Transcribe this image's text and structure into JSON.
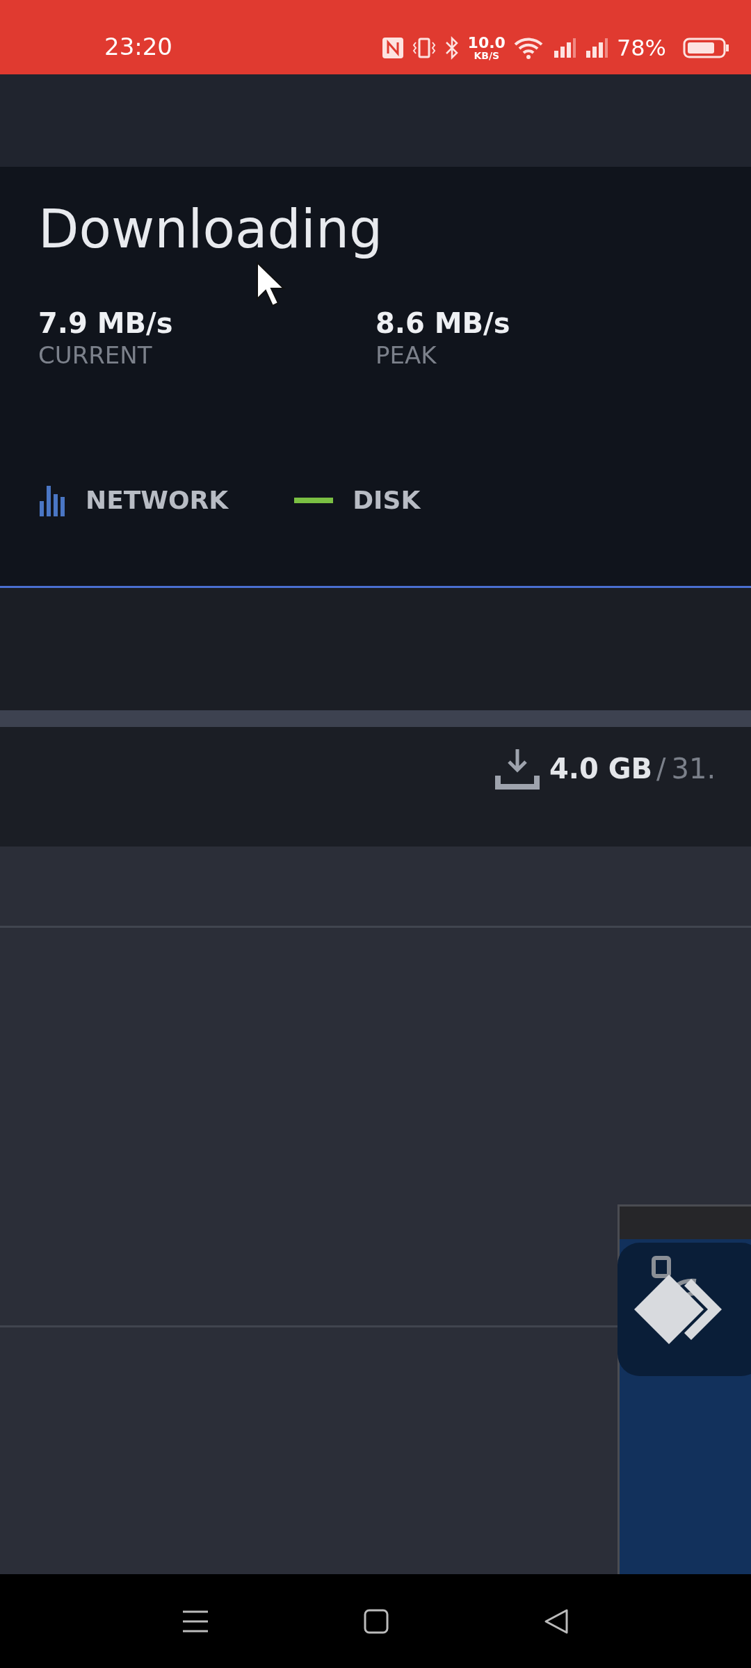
{
  "status_bar": {
    "time": "23:20",
    "net_speed": "10.0",
    "net_unit": "KB/S",
    "battery": "78%"
  },
  "downloads": {
    "title": "Downloading",
    "stats": [
      {
        "value": "7.9 MB/s",
        "label": "CURRENT"
      },
      {
        "value": "8.6 MB/s",
        "label": "PEAK"
      }
    ],
    "legend": [
      {
        "label": "NETWORK",
        "kind": "bars",
        "color": "#4a76c4"
      },
      {
        "label": "DISK",
        "kind": "line",
        "color": "#7bc043"
      }
    ],
    "progress": {
      "downloaded": "4.0 GB",
      "separator": "/",
      "total": "31."
    }
  }
}
